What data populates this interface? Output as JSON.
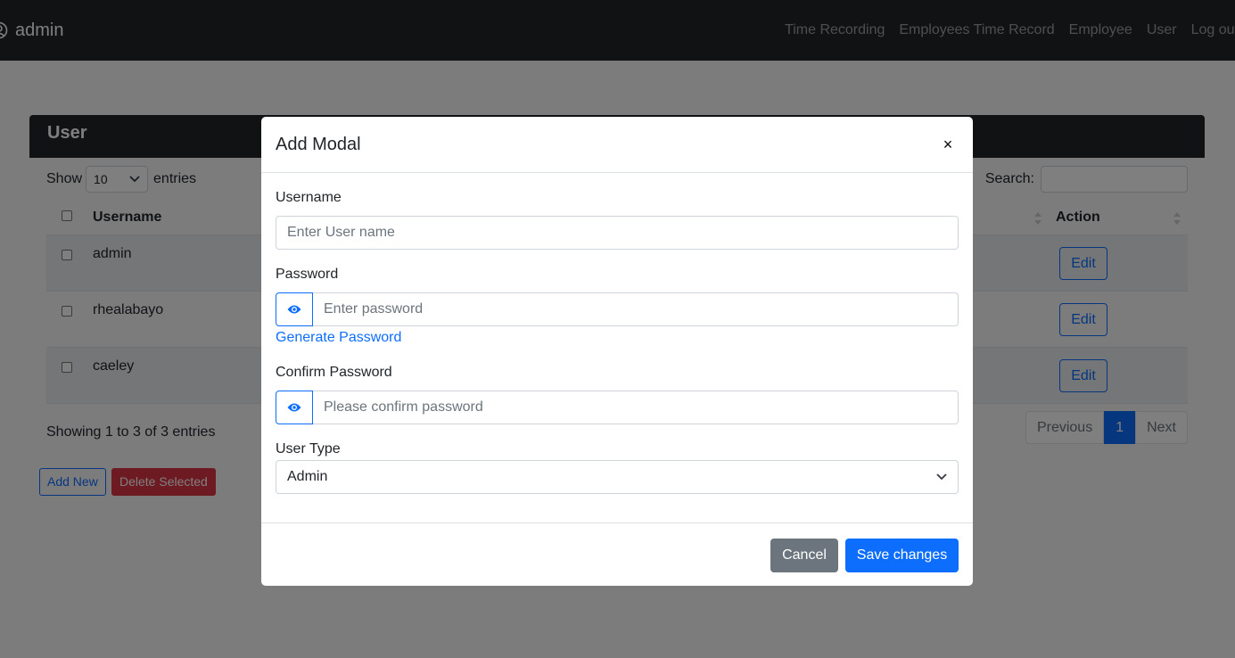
{
  "navbar": {
    "brand": "admin",
    "links": [
      "Time Recording",
      "Employees Time Record",
      "Employee",
      "User",
      "Log out"
    ]
  },
  "card": {
    "title": "User",
    "show_label": "Show",
    "entries_label": "entries",
    "length_value": "10",
    "search_label": "Search:",
    "columns": [
      "Username",
      "Action"
    ],
    "rows": [
      {
        "username": "admin",
        "action": "Edit"
      },
      {
        "username": "rhealabayo",
        "action": "Edit"
      },
      {
        "username": "caeley",
        "action": "Edit"
      }
    ],
    "info": "Showing 1 to 3 of 3 entries",
    "pagination": {
      "previous": "Previous",
      "page": "1",
      "next": "Next"
    },
    "add_new": "Add New",
    "delete_selected": "Delete Selected"
  },
  "modal": {
    "title": "Add Modal",
    "close": "×",
    "username_label": "Username",
    "username_placeholder": "Enter User name",
    "password_label": "Password",
    "password_placeholder": "Enter password",
    "generate_password": "Generate Password",
    "confirm_label": "Confirm Password",
    "confirm_placeholder": "Please confirm password",
    "user_type_label": "User Type",
    "user_type_value": "Admin",
    "cancel": "Cancel",
    "save": "Save changes"
  },
  "colors": {
    "primary": "#0d6efd",
    "danger": "#dc3545",
    "secondary": "#6c757d",
    "dark": "#212529"
  }
}
